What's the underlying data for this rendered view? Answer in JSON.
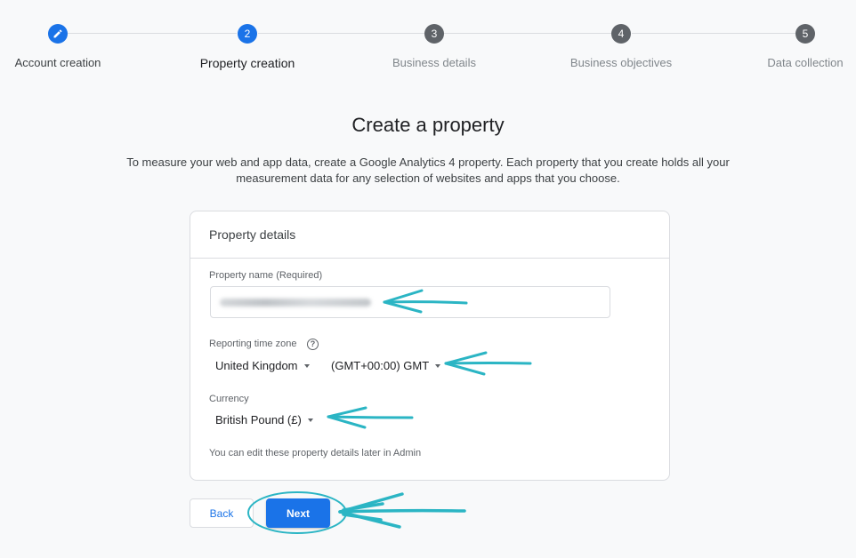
{
  "stepper": {
    "steps": [
      {
        "label": "Account creation",
        "number": "",
        "state": "done",
        "icon": "pencil-icon"
      },
      {
        "label": "Property creation",
        "number": "2",
        "state": "active"
      },
      {
        "label": "Business details",
        "number": "3",
        "state": "pending"
      },
      {
        "label": "Business objectives",
        "number": "4",
        "state": "pending"
      },
      {
        "label": "Data collection",
        "number": "5",
        "state": "pending"
      }
    ]
  },
  "page": {
    "title": "Create a property",
    "description": "To measure your web and app data, create a Google Analytics 4 property. Each property that you create holds all your measurement data for any selection of websites and apps that you choose."
  },
  "card": {
    "header": "Property details",
    "property_name_label": "Property name (Required)",
    "property_name_value": "",
    "time_zone_label": "Reporting time zone",
    "help_icon_glyph": "?",
    "country": "United Kingdom",
    "time_zone": "(GMT+00:00) GMT",
    "currency_label": "Currency",
    "currency": "British Pound (£)",
    "hint": "You can edit these property details later in Admin"
  },
  "buttons": {
    "back": "Back",
    "next": "Next"
  },
  "colors": {
    "accent": "#1a73e8",
    "annotation": "#2bb5c4",
    "pending_step": "#5f6368"
  }
}
